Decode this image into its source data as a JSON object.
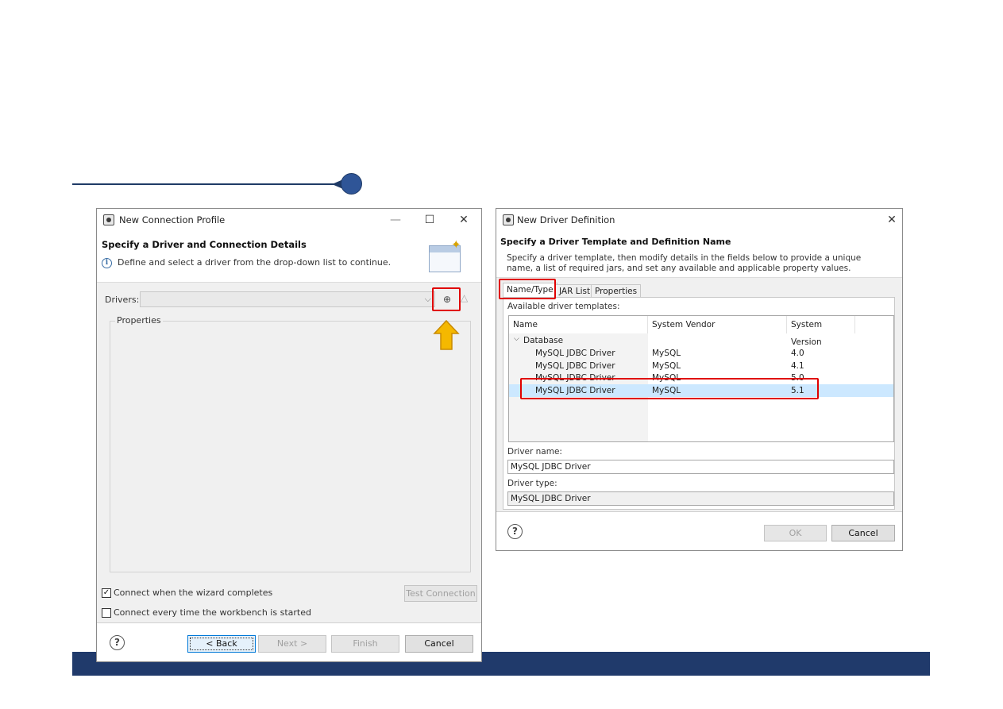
{
  "left_dialog": {
    "title": "New Connection Profile",
    "controls": {
      "minimize": "—",
      "maximize": "☐",
      "close": "✕"
    },
    "header_title": "Specify a Driver and Connection Details",
    "header_desc": "Define and select a driver from the drop-down list to continue.",
    "drivers_label": "Drivers:",
    "drivers_value": "",
    "properties_legend": "Properties",
    "connect_wizard_label": "Connect when the wizard completes",
    "connect_wizard_checked": "✓",
    "connect_every_label": "Connect every time the workbench is started",
    "test_connection": "Test Connection",
    "buttons": {
      "back": "< Back",
      "next": "Next >",
      "finish": "Finish",
      "cancel": "Cancel"
    }
  },
  "right_dialog": {
    "title": "New Driver Definition",
    "close": "✕",
    "header_title": "Specify a Driver Template and Definition Name",
    "header_desc_1": "Specify a driver template, then modify details in the fields below to provide a unique",
    "header_desc_2": "name, a list of required jars, and set any available and applicable property values.",
    "tabs": [
      "Name/Type",
      "JAR List",
      "Properties"
    ],
    "templates_label": "Available driver templates:",
    "columns": [
      "Name",
      "System Vendor",
      "System Version"
    ],
    "group": "Database",
    "rows": [
      {
        "name": "MySQL JDBC Driver",
        "vendor": "MySQL",
        "version": "4.0"
      },
      {
        "name": "MySQL JDBC Driver",
        "vendor": "MySQL",
        "version": "4.1"
      },
      {
        "name": "MySQL JDBC Driver",
        "vendor": "MySQL",
        "version": "5.0"
      },
      {
        "name": "MySQL JDBC Driver",
        "vendor": "MySQL",
        "version": "5.1"
      }
    ],
    "driver_name_label": "Driver name:",
    "driver_name_value": "MySQL JDBC Driver",
    "driver_type_label": "Driver type:",
    "driver_type_value": "MySQL JDBC Driver",
    "buttons": {
      "ok": "OK",
      "cancel": "Cancel"
    }
  },
  "colors": {
    "highlight": "#e00000",
    "arrow": "#f5b800",
    "slide_accent": "#203a6b"
  }
}
